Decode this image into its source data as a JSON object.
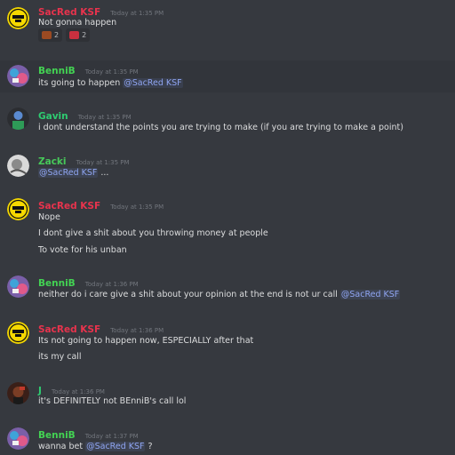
{
  "colors": {
    "background": "#36393f",
    "sacred": "#e8334d",
    "bennib": "#43d353",
    "gavin": "#2ecc71",
    "zacki": "#47c95a",
    "j": "#2ecc71",
    "mention": "#8fa5f2",
    "timestamp": "#72767d"
  },
  "messages": [
    {
      "author": "SacRed KSF",
      "time": "Today at 1:35 PM",
      "lines": [
        "Not gonna happen"
      ],
      "reactions": [
        {
          "icon": "poop-emoji",
          "count": "2"
        },
        {
          "icon": "angry-emoji",
          "count": "2"
        }
      ]
    },
    {
      "author": "BenniB",
      "time": "Today at 1:35 PM",
      "lines": [
        "its going to happen "
      ],
      "mention": "@SacRed KSF"
    },
    {
      "author": "Gavin",
      "time": "Today at 1:35 PM",
      "lines": [
        "i dont understand the points you are trying to make (if you are trying to make a point)"
      ]
    },
    {
      "author": "Zacki",
      "time": "Today at 1:35 PM",
      "mention": "@SacRed KSF",
      "lines_after": " ..."
    },
    {
      "author": "SacRed KSF",
      "time": "Today at 1:35 PM",
      "lines": [
        "Nope",
        "I dont give a shit about you throwing money at people",
        "To vote for his unban"
      ]
    },
    {
      "author": "BenniB",
      "time": "Today at 1:36 PM",
      "lines": [
        "neither do i care give a shit about your opinion at the end is not ur call "
      ],
      "mention": "@SacRed KSF"
    },
    {
      "author": "SacRed KSF",
      "time": "Today at 1:36 PM",
      "lines": [
        "Its not going to happen now, ESPECIALLY after that",
        "its my call"
      ]
    },
    {
      "author": "J",
      "time": "Today at 1:36 PM",
      "lines": [
        "it's DEFINITELY not BEnniB's call lol"
      ]
    },
    {
      "author": "BenniB",
      "time": "Today at 1:37 PM",
      "lines": [
        "wanna bet "
      ],
      "mention": "@SacRed KSF",
      "lines_after": " ?"
    }
  ]
}
